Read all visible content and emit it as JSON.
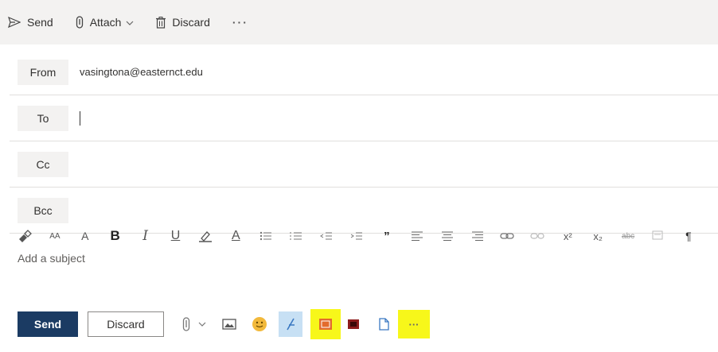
{
  "commandbar": {
    "send_label": "Send",
    "attach_label": "Attach",
    "discard_label": "Discard",
    "more_label": "···"
  },
  "fields": {
    "from_label": "From",
    "from_value": "vasingtona@easternct.edu",
    "to_label": "To",
    "to_value": "",
    "cc_label": "Cc",
    "bcc_label": "Bcc",
    "subject_placeholder": "Add a subject"
  },
  "format_toolbar": {
    "items": [
      {
        "name": "format-painter-icon"
      },
      {
        "name": "font-size-decrease-icon",
        "text": "AA"
      },
      {
        "name": "font-size-increase-icon",
        "text": "A"
      },
      {
        "name": "bold-icon",
        "text": "B"
      },
      {
        "name": "italic-icon",
        "text": "I"
      },
      {
        "name": "underline-icon",
        "text": "U"
      },
      {
        "name": "highlight-icon"
      },
      {
        "name": "font-color-icon",
        "text": "A"
      },
      {
        "name": "bullets-icon"
      },
      {
        "name": "numbering-icon"
      },
      {
        "name": "decrease-indent-icon"
      },
      {
        "name": "increase-indent-icon"
      },
      {
        "name": "quote-icon",
        "text": "”"
      },
      {
        "name": "align-left-icon"
      },
      {
        "name": "align-center-icon"
      },
      {
        "name": "align-right-icon"
      },
      {
        "name": "link-icon"
      },
      {
        "name": "unlink-icon"
      },
      {
        "name": "superscript-icon",
        "text": "x²"
      },
      {
        "name": "subscript-icon",
        "text": "x₂"
      },
      {
        "name": "strikethrough-icon",
        "text": "abc"
      },
      {
        "name": "clear-formatting-icon"
      },
      {
        "name": "paragraph-direction-icon",
        "text": "¶"
      }
    ]
  },
  "actionbar": {
    "send_label": "Send",
    "discard_label": "Discard",
    "more_label": "···"
  },
  "colors": {
    "commandbar_bg": "#f3f2f1",
    "send_button": "#1b3b63",
    "highlight_yellow": "#f7f71a",
    "highlight_blue": "#c7e0f4",
    "divider": "#e1dfdd"
  }
}
